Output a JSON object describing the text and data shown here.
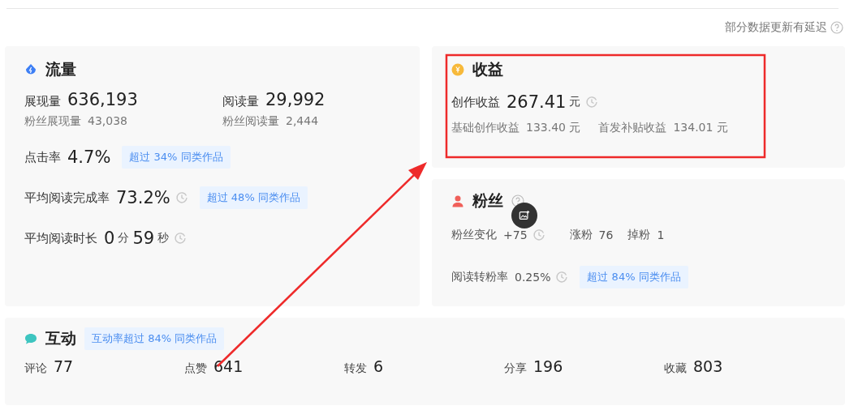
{
  "notice": {
    "text": "部分数据更新有延迟"
  },
  "traffic": {
    "title": "流量",
    "metrics": [
      {
        "label": "展现量",
        "value": "636,193",
        "kind": "main"
      },
      {
        "label": "阅读量",
        "value": "29,992",
        "kind": "main"
      },
      {
        "label": "粉丝展现量",
        "value": "43,038",
        "kind": "sub"
      },
      {
        "label": "粉丝阅读量",
        "value": "2,444",
        "kind": "sub"
      }
    ],
    "rates": [
      {
        "label": "点击率",
        "parts": [
          {
            "text": "4.7%",
            "kind": "num"
          }
        ],
        "clock": false,
        "badge": "超过 34% 同类作品"
      },
      {
        "label": "平均阅读完成率",
        "parts": [
          {
            "text": "73.2%",
            "kind": "num"
          }
        ],
        "clock": true,
        "badge": "超过 48% 同类作品"
      },
      {
        "label": "平均阅读时长",
        "parts": [
          {
            "text": "0",
            "kind": "num"
          },
          {
            "text": "分",
            "kind": "unit"
          },
          {
            "text": "59",
            "kind": "num"
          },
          {
            "text": "秒",
            "kind": "unit"
          }
        ],
        "clock": true
      }
    ]
  },
  "income": {
    "title": "收益",
    "main": {
      "label": "创作收益",
      "value": "267.41",
      "unit": "元"
    },
    "subs": [
      {
        "label": "基础创作收益",
        "value": "133.40 元"
      },
      {
        "label": "首发补贴收益",
        "value": "134.01 元"
      }
    ]
  },
  "fans": {
    "title": "粉丝",
    "change": {
      "label": "粉丝变化",
      "value": "+75"
    },
    "gain": {
      "label": "涨粉",
      "value": "76"
    },
    "loss": {
      "label": "掉粉",
      "value": "1"
    },
    "conversion": {
      "label": "阅读转粉率",
      "value": "0.25%",
      "badge": "超过 84% 同类作品"
    }
  },
  "interaction": {
    "title": "互动",
    "badge": "互动率超过 84% 同类作品",
    "stats": [
      {
        "label": "评论",
        "value": "77"
      },
      {
        "label": "点赞",
        "value": "641"
      },
      {
        "label": "转发",
        "value": "6"
      },
      {
        "label": "分享",
        "value": "196"
      },
      {
        "label": "收藏",
        "value": "803"
      }
    ]
  }
}
